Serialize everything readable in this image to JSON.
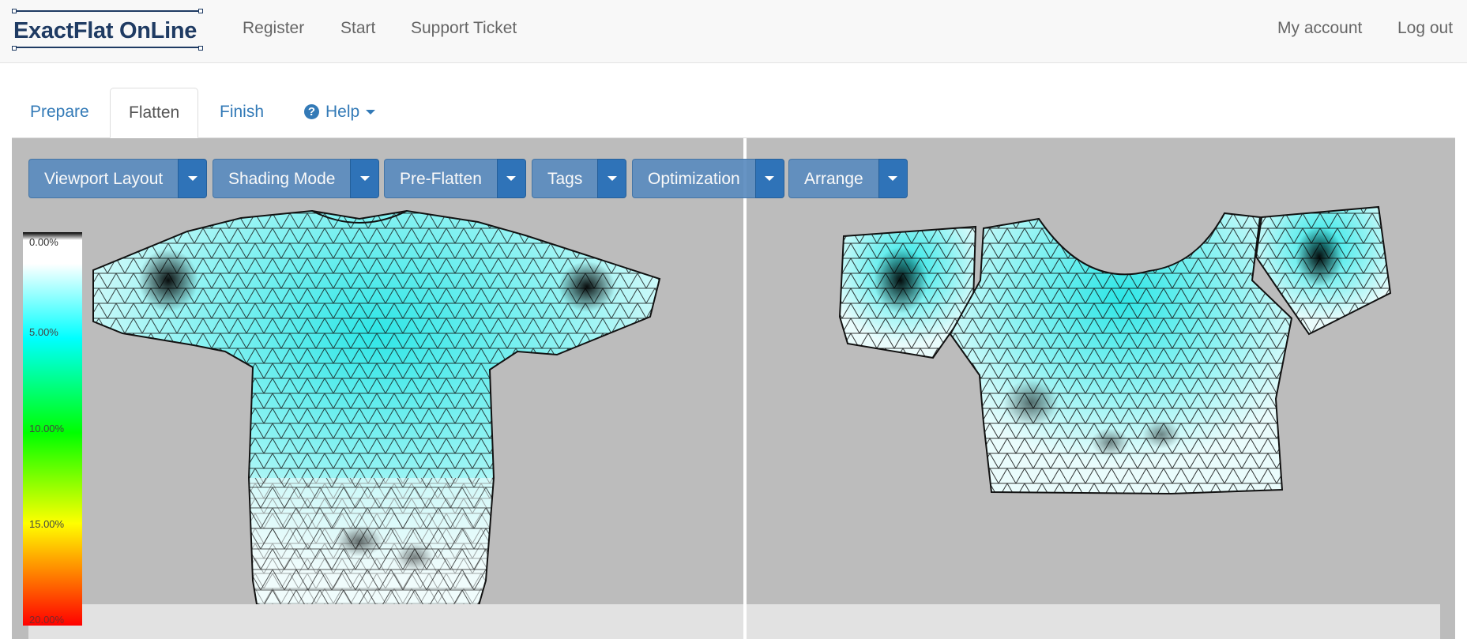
{
  "navbar": {
    "logo_text": "ExactFlat OnLine",
    "links_left": [
      "Register",
      "Start",
      "Support Ticket"
    ],
    "links_right": [
      "My account",
      "Log out"
    ]
  },
  "tabs": {
    "prepare": "Prepare",
    "flatten": "Flatten",
    "finish": "Finish",
    "help": "Help",
    "help_icon": "question-circle-icon",
    "active": "Flatten"
  },
  "toolbar": {
    "viewport_layout": "Viewport Layout",
    "shading_mode": "Shading Mode",
    "pre_flatten": "Pre-Flatten",
    "tags": "Tags",
    "optimization": "Optimization",
    "arrange": "Arrange"
  },
  "legend": {
    "top_label": "0.00%",
    "labels": [
      "5.00%",
      "10.00%",
      "15.00%",
      "20.00%"
    ],
    "colors": [
      "#000000",
      "#ffffff",
      "#00ffff",
      "#00ff00",
      "#ffff00",
      "#ff0000"
    ]
  },
  "colors": {
    "brand": "#1f3b63",
    "link": "#337ab7",
    "viewer_bg": "#bcbcbc",
    "mesh_cyan": "#3fe0e0"
  }
}
